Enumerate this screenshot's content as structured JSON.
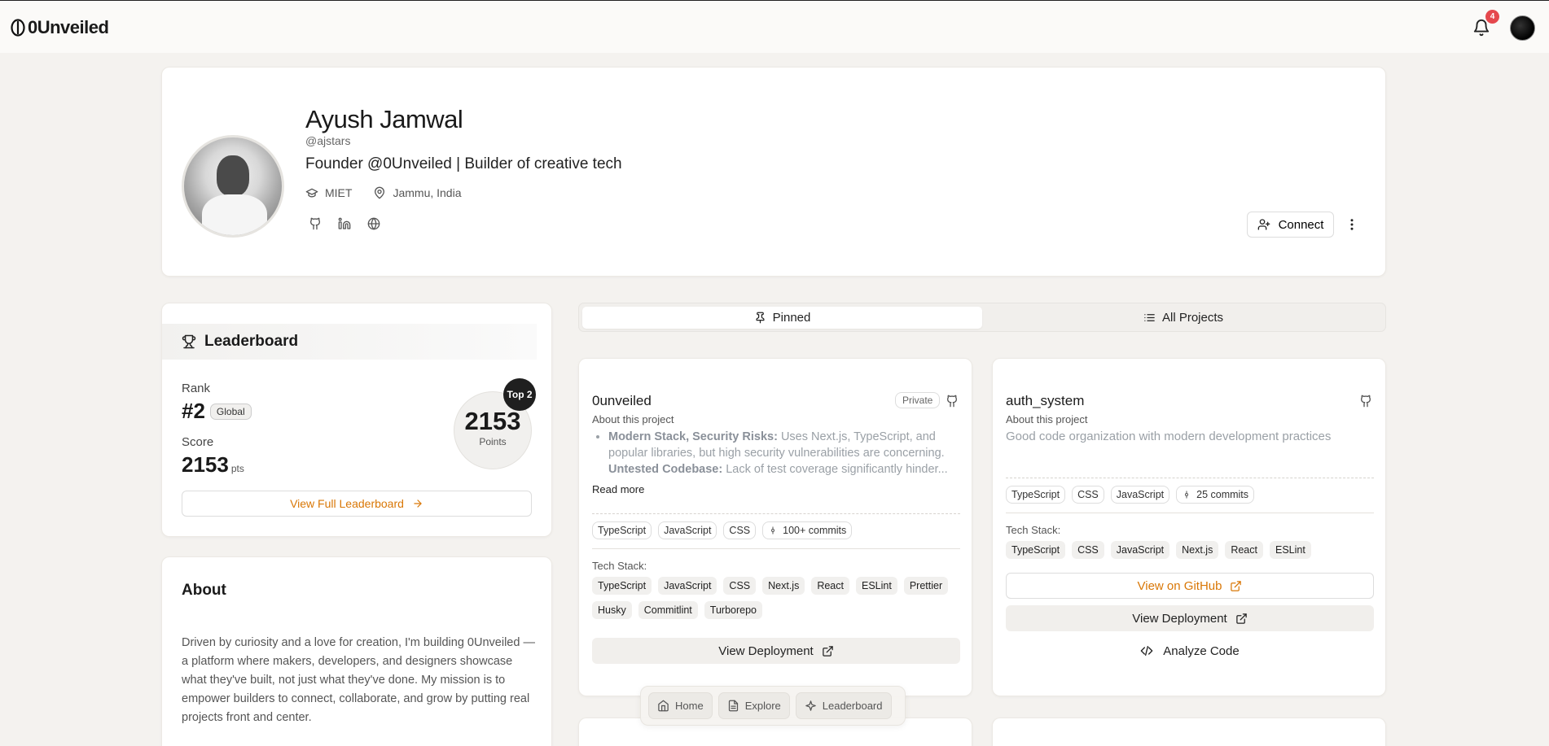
{
  "app": {
    "name": "0Unveiled"
  },
  "topbar": {
    "notification_count": "4"
  },
  "profile": {
    "name": "Ayush Jamwal",
    "handle": "@ajstars",
    "bio": "Founder @0Unveiled | Builder of creative tech",
    "college": "MIET",
    "location": "Jammu, India",
    "connect_label": "Connect"
  },
  "leaderboard": {
    "title": "Leaderboard",
    "rank_label": "Rank",
    "rank": "#2",
    "rank_scope": "Global",
    "score_label": "Score",
    "score": "2153",
    "score_unit": "pts",
    "points": "2153",
    "points_label": "Points",
    "top_badge": "Top 2",
    "button_label": "View Full Leaderboard"
  },
  "about": {
    "title": "About",
    "text": "Driven by curiosity and a love for creation, I'm building 0Unveiled — a platform where makers, developers, and designers showcase what they've built, not just what they've done. My mission is to empower builders to connect, collaborate, and grow by putting real projects front and center."
  },
  "tabs": {
    "pinned": "Pinned",
    "all": "All Projects"
  },
  "projects": [
    {
      "title": "0unveiled",
      "visibility": "Private",
      "subtitle": "About this project",
      "bullets": [
        {
          "bold": "Modern Stack, Security Risks:",
          "text": " Uses Next.js, TypeScript, and popular libraries, but high security vulnerabilities are concerning."
        },
        {
          "bold": "Untested Codebase:",
          "text": " Lack of test coverage significantly hinder..."
        }
      ],
      "read_more": "Read more",
      "languages": [
        "TypeScript",
        "JavaScript",
        "CSS"
      ],
      "commits": "100+ commits",
      "tech_label": "Tech Stack:",
      "tech": [
        "TypeScript",
        "JavaScript",
        "CSS",
        "Next.js",
        "React",
        "ESLint",
        "Prettier",
        "Husky",
        "Commitlint",
        "Turborepo"
      ],
      "deploy_label": "View Deployment"
    },
    {
      "title": "auth_system",
      "subtitle": "About this project",
      "description": "Good code organization with modern development practices",
      "languages": [
        "TypeScript",
        "CSS",
        "JavaScript"
      ],
      "commits": "25 commits",
      "tech_label": "Tech Stack:",
      "tech": [
        "TypeScript",
        "CSS",
        "JavaScript",
        "Next.js",
        "React",
        "ESLint"
      ],
      "github_label": "View on GitHub",
      "deploy_label": "View Deployment",
      "analyze_label": "Analyze Code"
    }
  ],
  "bottom_nav": {
    "home": "Home",
    "explore": "Explore",
    "leaderboard": "Leaderboard"
  },
  "colors": {
    "accent": "#d97706",
    "badge": "#e5484d",
    "background": "#f4f2ef"
  }
}
